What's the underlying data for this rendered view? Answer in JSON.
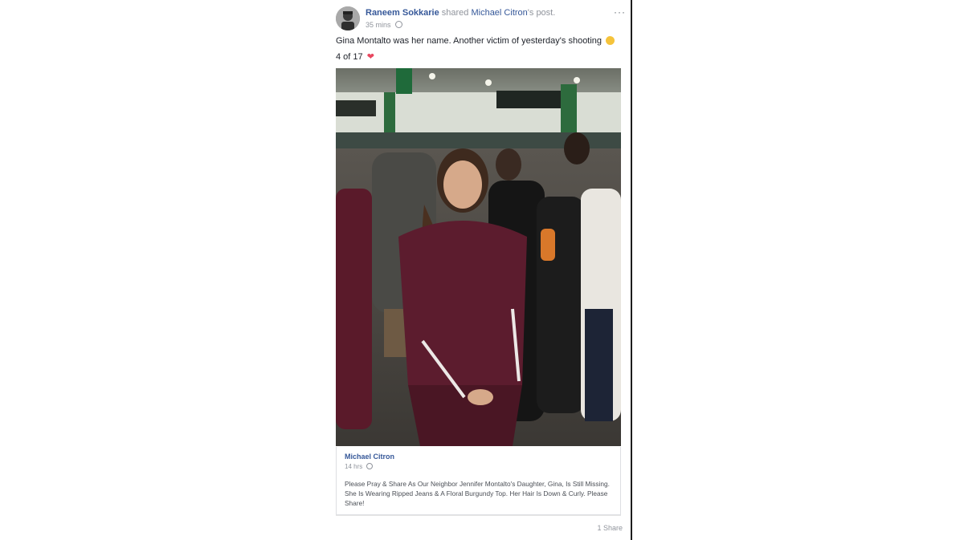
{
  "post": {
    "author": "Raneem Sokkarie",
    "action": " shared ",
    "original_author": "Michael Citron",
    "object": "'s post.",
    "time": "35 mins",
    "more_label": "···",
    "text": "Gina Montalto was her name. Another victim of yesterday's shooting",
    "counter": "4 of 17"
  },
  "shared": {
    "author": "Michael Citron",
    "time": "14 hrs",
    "body": "Please Pray & Share As Our Neighbor Jennifer Montalto's Daughter, Gina, Is Still Missing. She Is Wearing Ripped Jeans & A Floral Burgundy Top. Her Hair Is Down & Curly. Please Share!"
  },
  "footer": {
    "shares": "1 Share"
  },
  "icons": {
    "privacy": "globe-icon",
    "emoji": "crying-face-icon",
    "heart": "broken-heart-icon",
    "more": "more-options-icon"
  },
  "colors": {
    "link": "#365899",
    "meta": "#90949c",
    "text": "#1d2129",
    "heart": "#e8475f"
  }
}
